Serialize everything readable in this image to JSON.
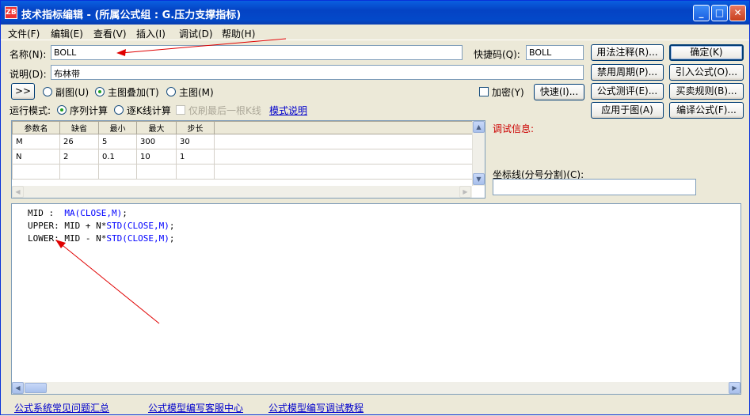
{
  "window": {
    "title": "技术指标编辑  - (所属公式组  : G.压力支撑指标)",
    "min_label": "_",
    "max_label": "□",
    "close_label": "✕"
  },
  "menu": [
    "文件(F)",
    "编辑(E)",
    "查看(V)",
    "插入(I)",
    "调试(D)",
    "帮助(H)"
  ],
  "form": {
    "name_label": "名称(N):",
    "name_value": "BOLL",
    "hotkey_label": "快捷码(Q):",
    "hotkey_value": "BOLL",
    "desc_label": "说明(D):",
    "desc_value": "布林带",
    "expand_label": ">>",
    "sub_chart_label": "副图(U)",
    "main_overlay_label": "主图叠加(T)",
    "main_chart_label": "主图(M)",
    "encrypt_label": "加密(Y)",
    "fast_label": "快速(I)...",
    "run_mode_label": "运行模式:",
    "seq_calc_label": "序列计算",
    "bar_calc_label": "逐K线计算",
    "last_bar_label": "仅刷最后一根K线",
    "mode_link": "模式说明"
  },
  "buttons": {
    "usage_note": "用法注释(R)...",
    "confirm": "确定(K)",
    "disable_period": "禁用周期(P)...",
    "import_formula": "引入公式(O)...",
    "formula_test": "公式测评(E)...",
    "trade_rule": "买卖规则(B)...",
    "apply_chart": "应用于图(A)",
    "compile": "编译公式(F)..."
  },
  "params": {
    "headers": [
      "参数名",
      "缺省",
      "最小",
      "最大",
      "步长"
    ],
    "rows": [
      [
        "M",
        "26",
        "5",
        "300",
        "30"
      ],
      [
        "N",
        "2",
        "0.1",
        "10",
        "1"
      ]
    ]
  },
  "debug": {
    "label": "调试信息:",
    "axis_label": "坐标线(分号分割)(C):",
    "axis_value": ""
  },
  "code": {
    "line1_a": "MID :  ",
    "line1_b": "MA(CLOSE,M)",
    "line1_c": ";",
    "line2_a": "UPPER: MID + N*",
    "line2_b": "STD(CLOSE,M)",
    "line2_c": ";",
    "line3_a": "LOWER: MID - N*",
    "line3_b": "STD(CLOSE,M)",
    "line3_c": ";"
  },
  "footer_links": [
    "公式系统常见问题汇总",
    "公式模型编写客服中心",
    "公式模型编写调试教程"
  ],
  "colors": {
    "accent": "#0a5fe0",
    "arrow": "#e00000",
    "keyword": "#0000ff",
    "debug": "#cc0000"
  }
}
